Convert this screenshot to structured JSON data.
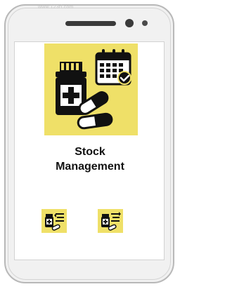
{
  "device": {
    "watermark": "www.123rf.com"
  },
  "screen": {
    "title_line1": "Stock",
    "title_line2": "Management",
    "hero_icon": "medicine-calendar-icon",
    "action_icons": [
      "medicine-list-icon",
      "medicine-sort-icon"
    ]
  },
  "colors": {
    "tile": "#efe068",
    "ink": "#111111"
  }
}
